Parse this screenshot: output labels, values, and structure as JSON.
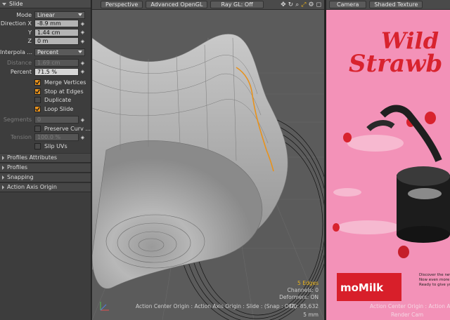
{
  "panel": {
    "title": "Slide",
    "mode": {
      "label": "Mode",
      "value": "Linear"
    },
    "direction": {
      "label_x": "Direction X",
      "x": "-8.9 mm",
      "label_y": "Y",
      "y": "1.44 cm",
      "label_z": "Z",
      "z": "0 m"
    },
    "interpolation": {
      "label": "Interpola ...",
      "value": "Percent"
    },
    "distance": {
      "label": "Distance",
      "value": "1.69 cm"
    },
    "percent": {
      "label": "Percent",
      "value": "71.5 %"
    },
    "checks": [
      {
        "label": "Merge Vertices",
        "checked": true
      },
      {
        "label": "Stop at Edges",
        "checked": true
      },
      {
        "label": "Duplicate",
        "checked": false
      },
      {
        "label": "Loop Slide",
        "checked": true
      }
    ],
    "segments": {
      "label": "Segments",
      "value": "0"
    },
    "preserve": {
      "label": "Preserve Curv ..."
    },
    "tension": {
      "label": "Tension",
      "value": "100.0 %"
    },
    "slip": {
      "label": "Slip UVs"
    },
    "sections": [
      "Profiles Attributes",
      "Profiles",
      "Snapping",
      "Action Axis Origin"
    ]
  },
  "viewport": {
    "tabs": [
      "Perspective",
      "Advanced OpenGL",
      "Ray GL: Off"
    ],
    "info": {
      "edges": "5 Edges",
      "channels": "Channels: 0",
      "deformers": "Deformers: ON",
      "gl": "GL: 85,632",
      "unit": "5 mm",
      "status": "Action Center Origin : Action Axis Origin : Slide : (Snap : OFF)"
    },
    "accent": "#e8921c"
  },
  "render": {
    "tabs": [
      "Camera",
      "Shaded Texture"
    ],
    "poster_title_1": "Wild",
    "poster_title_2": "Strawb",
    "brand": "moMilk",
    "tagline_1": "Discover the new fl",
    "tagline_2": "Now even more ta",
    "tagline_3": "Ready to give you m",
    "status": "Action Center Origin : Action Ax",
    "cam": "Render Cam"
  }
}
